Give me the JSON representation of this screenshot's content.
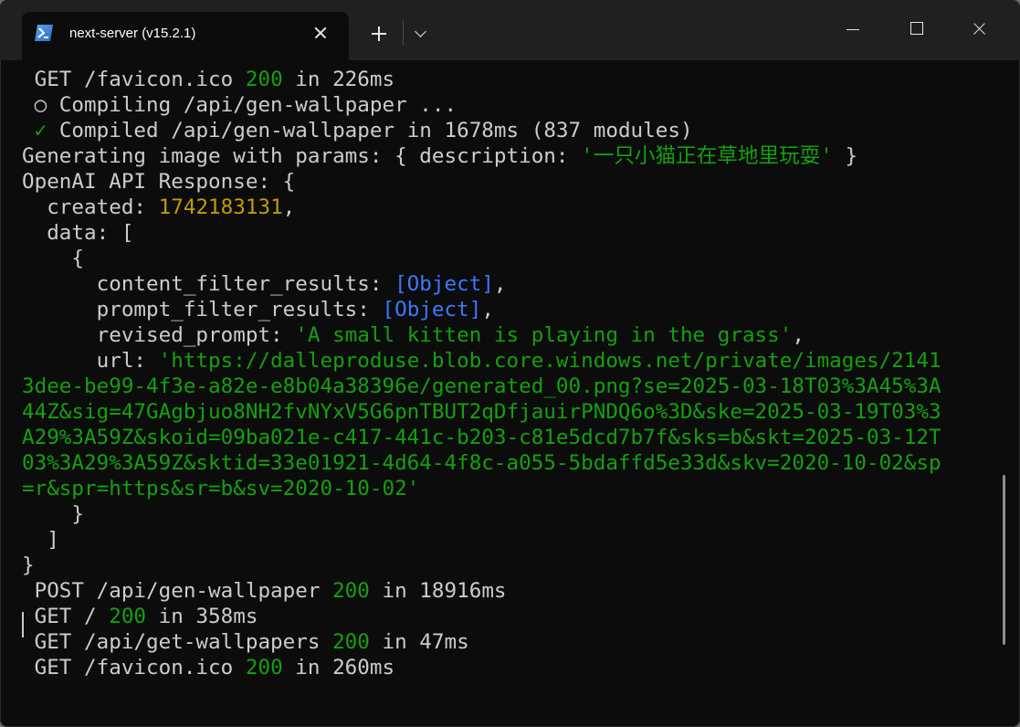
{
  "tab": {
    "title": "next-server (v15.2.1)",
    "icon": "powershell-icon"
  },
  "colors": {
    "green": "#13a10e",
    "yellow": "#c19c00",
    "blue": "#3b78ff",
    "text": "#cccccc",
    "bg": "#0c0c0c",
    "titlebar": "#202020"
  },
  "lines": [
    [
      {
        "t": " GET /favicon.ico ",
        "c": "w"
      },
      {
        "t": "200",
        "c": "g"
      },
      {
        "t": " in 226ms",
        "c": "w"
      }
    ],
    [
      {
        "t": " ○ Compiling /api/gen-wallpaper ...",
        "c": "w"
      }
    ],
    [
      {
        "t": " ",
        "c": "w"
      },
      {
        "t": "✓",
        "c": "g"
      },
      {
        "t": " Compiled /api/gen-wallpaper in 1678ms (837 modules)",
        "c": "w"
      }
    ],
    [
      {
        "t": "Generating image with params: { description: ",
        "c": "w"
      },
      {
        "t": "'一只小猫正在草地里玩耍'",
        "c": "g"
      },
      {
        "t": " }",
        "c": "w"
      }
    ],
    [
      {
        "t": "OpenAI API Response: {",
        "c": "w"
      }
    ],
    [
      {
        "t": "  created: ",
        "c": "w"
      },
      {
        "t": "1742183131",
        "c": "y"
      },
      {
        "t": ",",
        "c": "w"
      }
    ],
    [
      {
        "t": "  data: [",
        "c": "w"
      }
    ],
    [
      {
        "t": "    {",
        "c": "w"
      }
    ],
    [
      {
        "t": "      content_filter_results: ",
        "c": "w"
      },
      {
        "t": "[Object]",
        "c": "b"
      },
      {
        "t": ",",
        "c": "w"
      }
    ],
    [
      {
        "t": "      prompt_filter_results: ",
        "c": "w"
      },
      {
        "t": "[Object]",
        "c": "b"
      },
      {
        "t": ",",
        "c": "w"
      }
    ],
    [
      {
        "t": "      revised_prompt: ",
        "c": "w"
      },
      {
        "t": "'A small kitten is playing in the grass'",
        "c": "g"
      },
      {
        "t": ",",
        "c": "w"
      }
    ],
    [
      {
        "t": "      url: ",
        "c": "w"
      },
      {
        "t": "'https://dalleproduse.blob.core.windows.net/private/images/2141",
        "c": "g"
      }
    ],
    [
      {
        "t": "3dee-be99-4f3e-a82e-e8b04a38396e/generated_00.png?se=2025-03-18T03%3A45%3A",
        "c": "g"
      }
    ],
    [
      {
        "t": "44Z&sig=47GAgbjuo8NH2fvNYxV5G6pnTBUT2qDfjauirPNDQ6o%3D&ske=2025-03-19T03%3",
        "c": "g"
      }
    ],
    [
      {
        "t": "A29%3A59Z&skoid=09ba021e-c417-441c-b203-c81e5dcd7b7f&sks=b&skt=2025-03-12T",
        "c": "g"
      }
    ],
    [
      {
        "t": "03%3A29%3A59Z&sktid=33e01921-4d64-4f8c-a055-5bdaffd5e33d&skv=2020-10-02&sp",
        "c": "g"
      }
    ],
    [
      {
        "t": "=r&spr=https&sr=b&sv=2020-10-02'",
        "c": "g"
      }
    ],
    [
      {
        "t": "    }",
        "c": "w"
      }
    ],
    [
      {
        "t": "  ]",
        "c": "w"
      }
    ],
    [
      {
        "t": "}",
        "c": "w"
      }
    ],
    [
      {
        "t": " POST /api/gen-wallpaper ",
        "c": "w"
      },
      {
        "t": "200",
        "c": "g"
      },
      {
        "t": " in 18916ms",
        "c": "w"
      }
    ],
    [
      {
        "t": " GET / ",
        "c": "w"
      },
      {
        "t": "200",
        "c": "g"
      },
      {
        "t": " in 358ms",
        "c": "w"
      }
    ],
    [
      {
        "t": " GET /api/get-wallpapers ",
        "c": "w"
      },
      {
        "t": "200",
        "c": "g"
      },
      {
        "t": " in 47ms",
        "c": "w"
      }
    ],
    [
      {
        "t": " GET /favicon.ico ",
        "c": "w"
      },
      {
        "t": "200",
        "c": "g"
      },
      {
        "t": " in 260ms",
        "c": "w"
      }
    ]
  ]
}
